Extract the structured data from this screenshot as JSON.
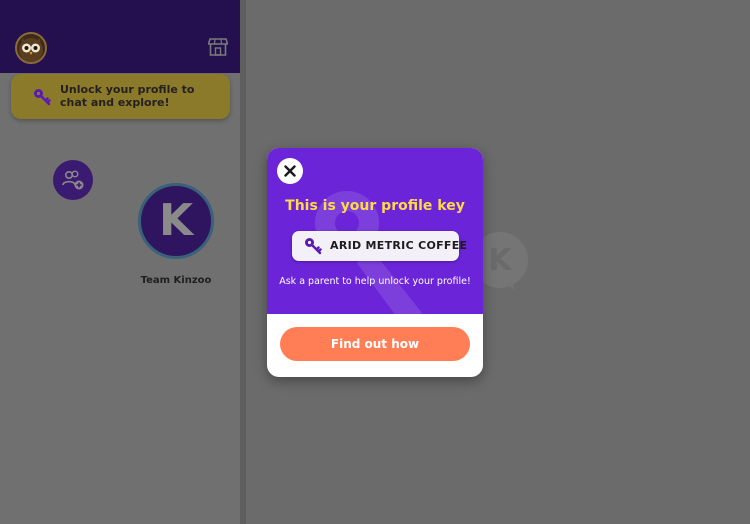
{
  "sidebar": {
    "avatar_icon": "owl-avatar-icon",
    "store_icon": "store-icon",
    "unlock_banner": {
      "text": "Unlock your profile to chat and explore!",
      "icon": "key-icon"
    },
    "add_contact_icon": "add-contact-icon",
    "contacts": [
      {
        "initial": "K",
        "name": "Team Kinzoo"
      }
    ]
  },
  "modal": {
    "close_icon": "close-icon",
    "title": "This is your profile key",
    "profile_key": "ARID METRIC COFFEE",
    "help_text": "Ask a parent to help unlock your profile!",
    "cta_label": "Find out how"
  },
  "colors": {
    "header": "#25104f",
    "modal_purple": "#6c24d8",
    "title_yellow": "#ffd94a",
    "cta_orange": "#ff7e55",
    "banner_yellow": "#8a7a2a"
  }
}
